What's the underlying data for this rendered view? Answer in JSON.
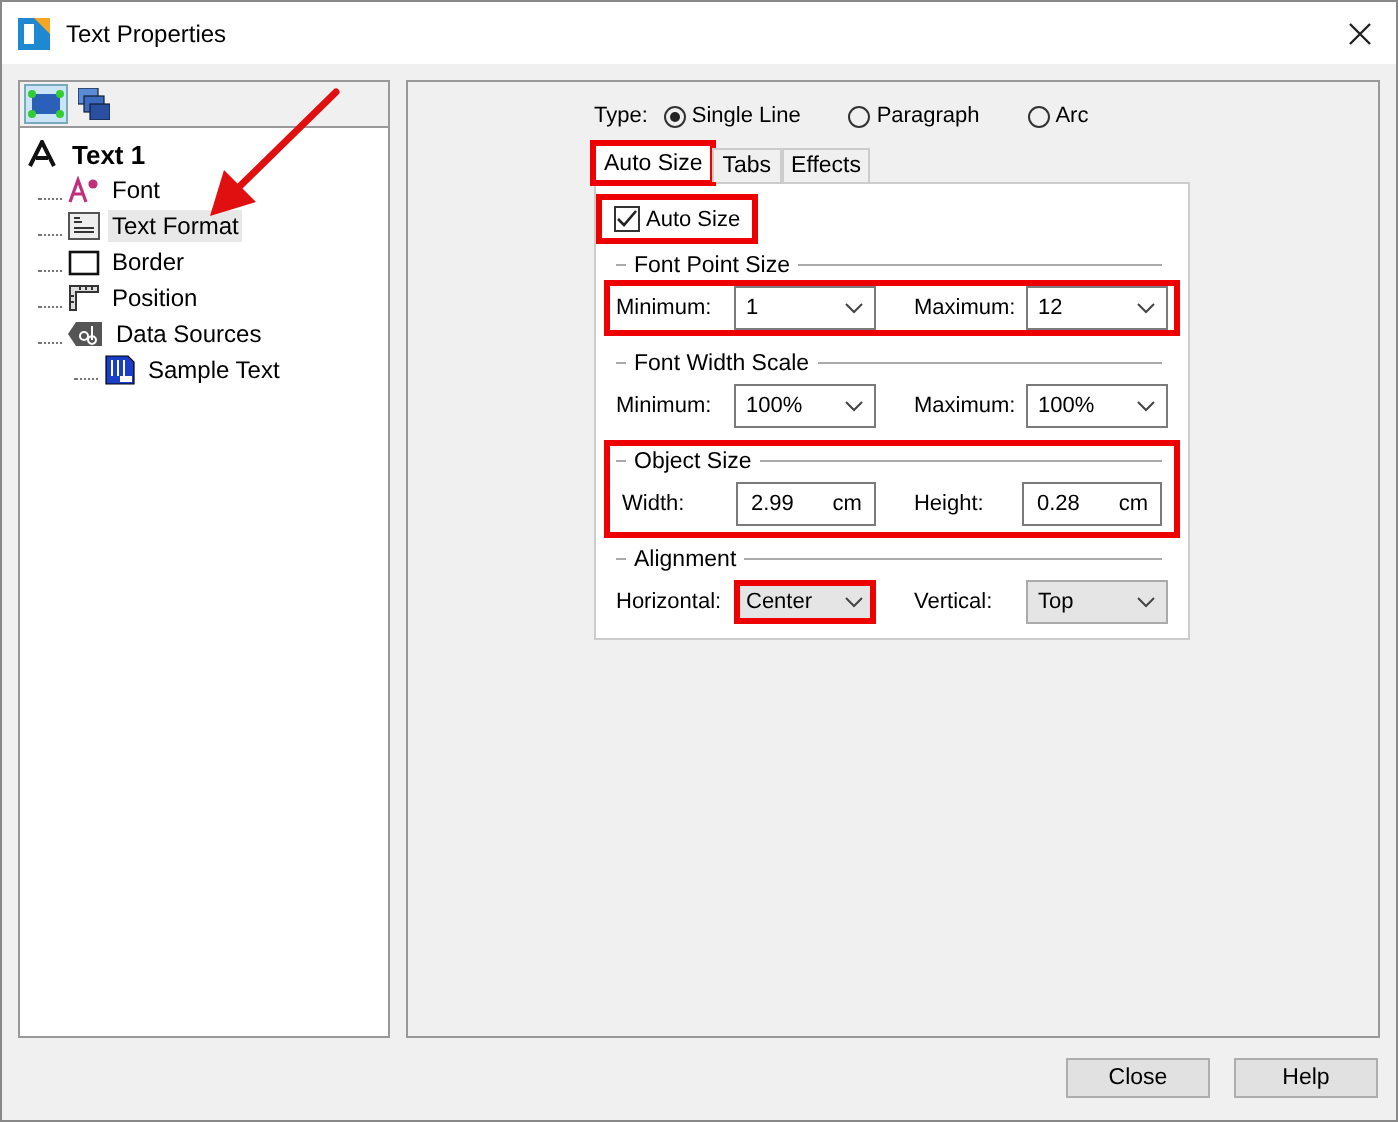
{
  "window": {
    "title": "Text Properties"
  },
  "tree_toolbar": [
    {
      "selected": true
    },
    {
      "selected": false
    }
  ],
  "tree": {
    "label": "Text 1",
    "kind": "text",
    "selected": false,
    "children": [
      {
        "label": "Font",
        "kind": "font",
        "selected": false
      },
      {
        "label": "Text Format",
        "kind": "format",
        "selected": true
      },
      {
        "label": "Border",
        "kind": "border",
        "selected": false
      },
      {
        "label": "Position",
        "kind": "position",
        "selected": false
      },
      {
        "label": "Data Sources",
        "kind": "source",
        "selected": false,
        "children": [
          {
            "label": "Sample Text",
            "kind": "sample",
            "selected": false
          }
        ]
      }
    ]
  },
  "type": {
    "label": "Type:",
    "options": [
      {
        "label": "Single Line",
        "selected": true
      },
      {
        "label": "Paragraph",
        "selected": false
      },
      {
        "label": "Arc",
        "selected": false
      }
    ]
  },
  "tabs": [
    {
      "label": "Auto Size",
      "selected": true,
      "highlighted": true
    },
    {
      "label": "Tabs",
      "selected": false,
      "highlighted": false
    },
    {
      "label": "Effects",
      "selected": false,
      "highlighted": false
    }
  ],
  "auto_size": {
    "label": "Auto Size",
    "checked": true,
    "highlighted": true
  },
  "groups": [
    {
      "title": "Font Point Size",
      "highlighted": false,
      "row_highlighted": true,
      "fields": [
        {
          "label": "Minimum:",
          "value": "1",
          "kind": "dropdown"
        },
        {
          "label": "Maximum:",
          "value": "12",
          "kind": "dropdown"
        }
      ]
    },
    {
      "title": "Font Width Scale",
      "highlighted": false,
      "row_highlighted": false,
      "fields": [
        {
          "label": "Minimum:",
          "value": "100%",
          "kind": "dropdown"
        },
        {
          "label": "Maximum:",
          "value": "100%",
          "kind": "dropdown"
        }
      ]
    },
    {
      "title": "Object Size",
      "highlighted": true,
      "row_highlighted": false,
      "fields": [
        {
          "label": "Width:",
          "value": "2.99",
          "unit": "cm",
          "kind": "unit"
        },
        {
          "label": "Height:",
          "value": "0.28",
          "unit": "cm",
          "kind": "unit"
        }
      ]
    },
    {
      "title": "Alignment",
      "highlighted": false,
      "row_highlighted": false,
      "fields": [
        {
          "label": "Horizontal:",
          "value": "Center",
          "kind": "dropdown",
          "highlighted": true
        },
        {
          "label": "Vertical:",
          "value": "Top",
          "kind": "dropdown",
          "highlighted": false
        }
      ]
    }
  ],
  "buttons": [
    "Close",
    "Help"
  ]
}
